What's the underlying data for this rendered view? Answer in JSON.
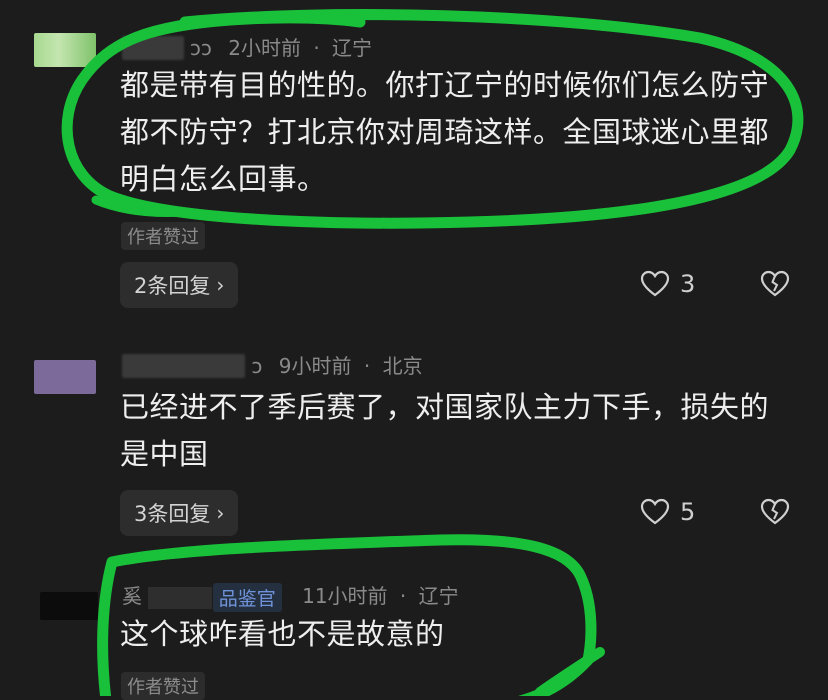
{
  "comments": [
    {
      "username_hidden": "▇▇▇▇",
      "username_tail": "ɔɔ",
      "time": "2小时前",
      "location": "辽宁",
      "text": "都是带有目的性的。你打辽宁的时候你们怎么防守都不防守？打北京你对周琦这样。全国球迷心里都明白怎么回事。",
      "author_liked": "作者赞过",
      "replies_label": "2条回复",
      "likes": "3",
      "avatar_color": "#9fd28a"
    },
    {
      "username_hidden": "▇▇▇▇▇▇▇▇",
      "username_tail": "ɔ",
      "time": "9小时前",
      "location": "北京",
      "text": "已经进不了季后赛了，对国家队主力下手，损失的是中国",
      "replies_label": "3条回复",
      "likes": "5",
      "avatar_color": "#7b6a9a"
    },
    {
      "username_prefix": "奚",
      "badge": "品鉴官",
      "time": "11小时前",
      "location": "辽宁",
      "text": "这个球咋看也不是故意的",
      "author_liked": "作者赞过",
      "avatar_color": "#111111"
    }
  ],
  "separator": "·",
  "icons": {
    "like": "heart-outline-icon",
    "dislike": "broken-heart-icon",
    "chevron": "chevron-right-icon"
  },
  "colors": {
    "background": "#1c1c1c",
    "annotation": "#19c13a",
    "badge": "#6f93d9"
  }
}
